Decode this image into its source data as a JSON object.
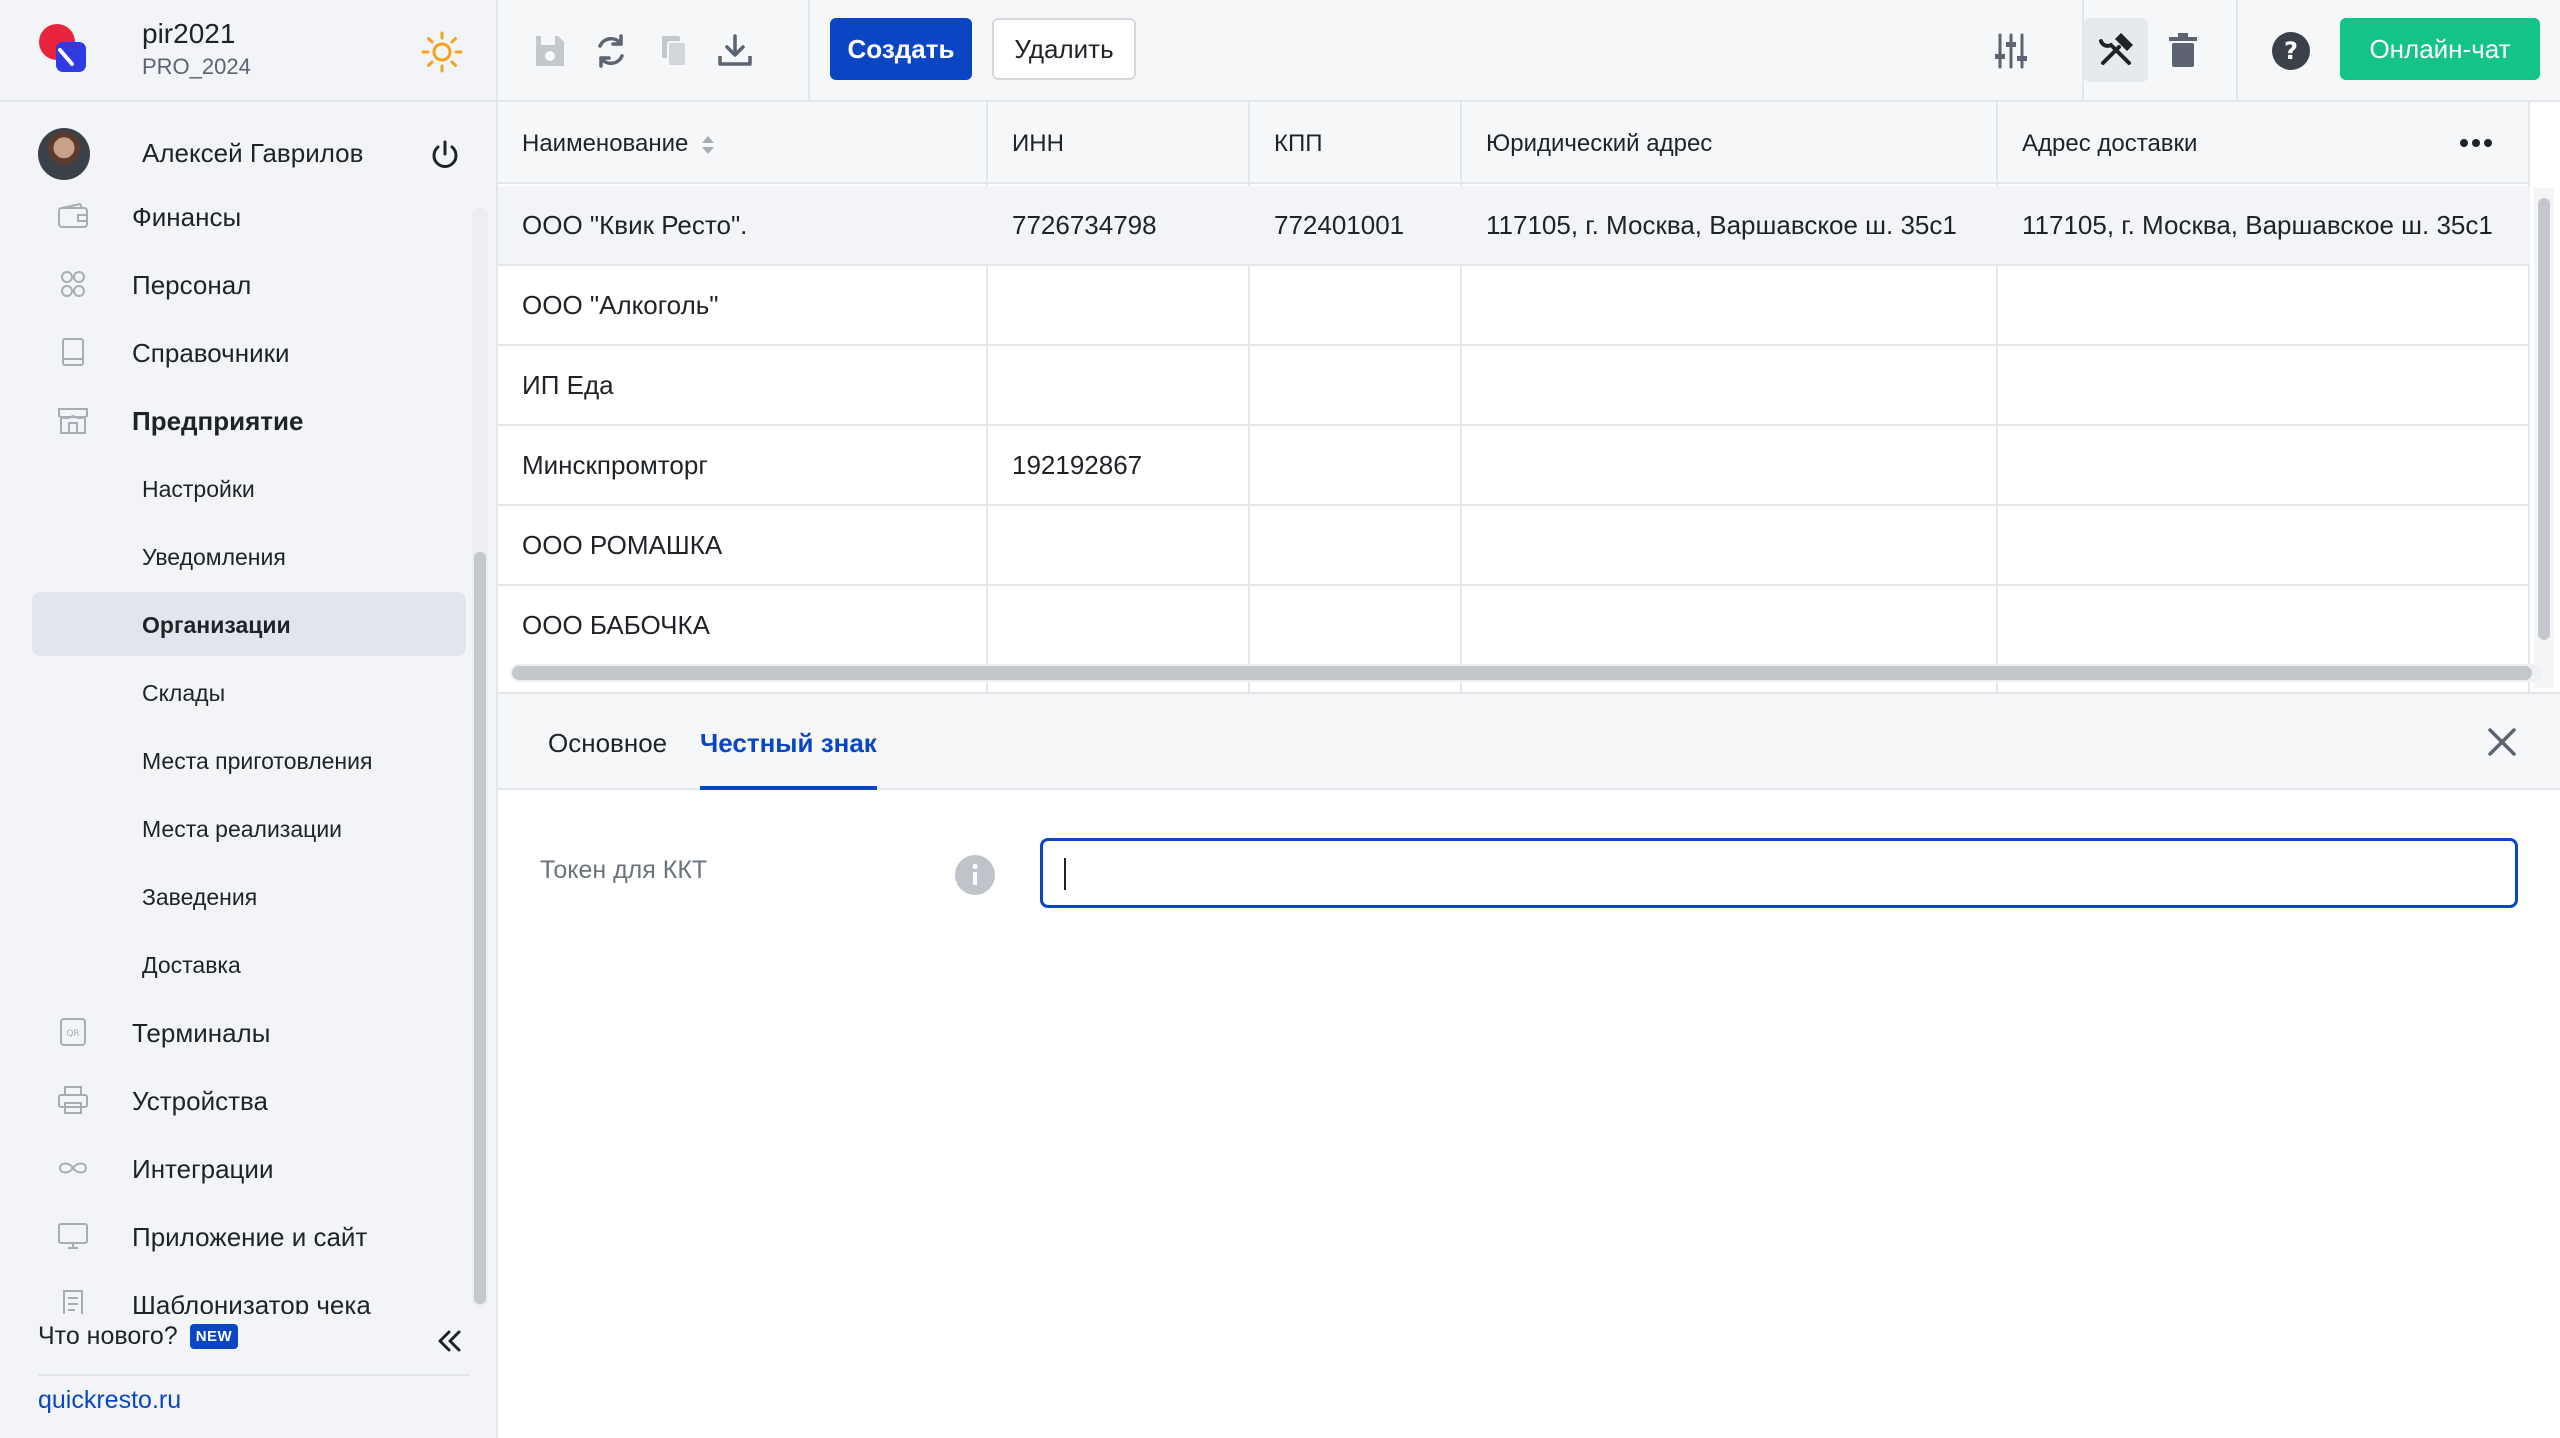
{
  "brand": {
    "name": "pir2021",
    "plan": "PRO_2024"
  },
  "user": {
    "name": "Алексей Гаврилов"
  },
  "nav": {
    "items": [
      {
        "label": "Финансы",
        "icon": "wallet-icon"
      },
      {
        "label": "Персонал",
        "icon": "people-icon"
      },
      {
        "label": "Справочники",
        "icon": "book-icon"
      },
      {
        "label": "Предприятие",
        "icon": "store-icon",
        "expanded": true
      },
      {
        "label": "Настройки",
        "sub": true
      },
      {
        "label": "Уведомления",
        "sub": true
      },
      {
        "label": "Организации",
        "sub": true,
        "active": true
      },
      {
        "label": "Склады",
        "sub": true
      },
      {
        "label": "Места приготовления",
        "sub": true
      },
      {
        "label": "Места реализации",
        "sub": true
      },
      {
        "label": "Заведения",
        "sub": true
      },
      {
        "label": "Доставка",
        "sub": true
      },
      {
        "label": "Терминалы",
        "icon": "qr-terminal-icon"
      },
      {
        "label": "Устройства",
        "icon": "printer-icon"
      },
      {
        "label": "Интеграции",
        "icon": "infinity-icon"
      },
      {
        "label": "Приложение и сайт",
        "icon": "monitor-icon"
      },
      {
        "label": "Шаблонизатор чека",
        "icon": "receipt-icon"
      }
    ]
  },
  "footer": {
    "whats_new": "Что нового?",
    "new_badge": "NEW",
    "site": "quickresto.ru"
  },
  "toolbar": {
    "create_label": "Создать",
    "delete_label": "Удалить",
    "chat_label": "Онлайн-чат"
  },
  "table": {
    "columns": [
      "Наименование",
      "ИНН",
      "КПП",
      "Юридический адрес",
      "Адрес доставки"
    ],
    "rows": [
      {
        "name": "ООО \"Квик Ресто\".",
        "inn": "7726734798",
        "kpp": "772401001",
        "legal": "117105, г. Москва, Варшавское ш. 35с1",
        "delivery": "117105, г. Москва, Варшавское ш. 35с1",
        "selected": true
      },
      {
        "name": "ООО \"Алкоголь\"",
        "inn": "",
        "kpp": "",
        "legal": "",
        "delivery": ""
      },
      {
        "name": "ИП Еда",
        "inn": "",
        "kpp": "",
        "legal": "",
        "delivery": ""
      },
      {
        "name": "Минскпромторг",
        "inn": "192192867",
        "kpp": "",
        "legal": "",
        "delivery": ""
      },
      {
        "name": "ООО РОМАШКА",
        "inn": "",
        "kpp": "",
        "legal": "",
        "delivery": ""
      },
      {
        "name": "ООО БАБОЧКА",
        "inn": "",
        "kpp": "",
        "legal": "",
        "delivery": ""
      }
    ]
  },
  "detail": {
    "tabs": [
      {
        "label": "Основное",
        "active": false
      },
      {
        "label": "Честный знак",
        "active": true
      }
    ],
    "field_label": "Токен для ККТ",
    "field_value": ""
  },
  "colors": {
    "accent": "#0a46c4",
    "chat": "#14c389",
    "brand_red": "#e8243c"
  }
}
